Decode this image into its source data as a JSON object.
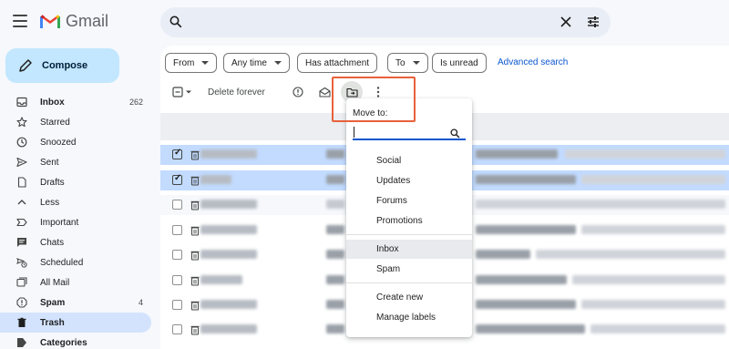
{
  "app": {
    "name": "Gmail"
  },
  "search": {
    "placeholder": "",
    "value": ""
  },
  "sidebar": {
    "compose_label": "Compose",
    "items": [
      {
        "label": "Inbox",
        "count": "262",
        "icon": "inbox-icon",
        "bold": true
      },
      {
        "label": "Starred",
        "count": "",
        "icon": "star-icon",
        "bold": false
      },
      {
        "label": "Snoozed",
        "count": "",
        "icon": "clock-icon",
        "bold": false
      },
      {
        "label": "Sent",
        "count": "",
        "icon": "send-icon",
        "bold": false
      },
      {
        "label": "Drafts",
        "count": "",
        "icon": "draft-icon",
        "bold": false
      },
      {
        "label": "Less",
        "count": "",
        "icon": "chevron-up-icon",
        "bold": false
      },
      {
        "label": "Important",
        "count": "",
        "icon": "important-icon",
        "bold": false
      },
      {
        "label": "Chats",
        "count": "",
        "icon": "chat-icon",
        "bold": false
      },
      {
        "label": "Scheduled",
        "count": "",
        "icon": "scheduled-icon",
        "bold": false
      },
      {
        "label": "All Mail",
        "count": "",
        "icon": "all-mail-icon",
        "bold": false
      },
      {
        "label": "Spam",
        "count": "4",
        "icon": "spam-icon",
        "bold": true
      },
      {
        "label": "Trash",
        "count": "",
        "icon": "trash-icon",
        "bold": true,
        "active": true
      },
      {
        "label": "Categories",
        "count": "",
        "icon": "label-icon",
        "bold": true
      }
    ]
  },
  "filters": {
    "chips": [
      "From",
      "Any time",
      "Has attachment",
      "To",
      "Is unread"
    ],
    "advanced_search": "Advanced search"
  },
  "toolbar": {
    "delete_forever": "Delete forever"
  },
  "move_menu": {
    "title": "Move to:",
    "search_value": "",
    "group1": [
      "Social",
      "Updates",
      "Forums",
      "Promotions"
    ],
    "group2": [
      "Inbox",
      "Spam"
    ],
    "group3": [
      "Create new",
      "Manage labels"
    ],
    "hovered": "Inbox"
  },
  "email_rows": [
    {
      "selected": true
    },
    {
      "selected": true
    },
    {
      "selected": false
    },
    {
      "selected": false
    },
    {
      "selected": false
    },
    {
      "selected": false
    },
    {
      "selected": false
    },
    {
      "selected": false
    },
    {
      "selected": false
    }
  ],
  "colors": {
    "accent": "#0b57d0",
    "compose_bg": "#c2e7ff",
    "active_nav": "#d3e3fd",
    "selected_row": "#c2dbff",
    "annotation": "#e8613b"
  }
}
